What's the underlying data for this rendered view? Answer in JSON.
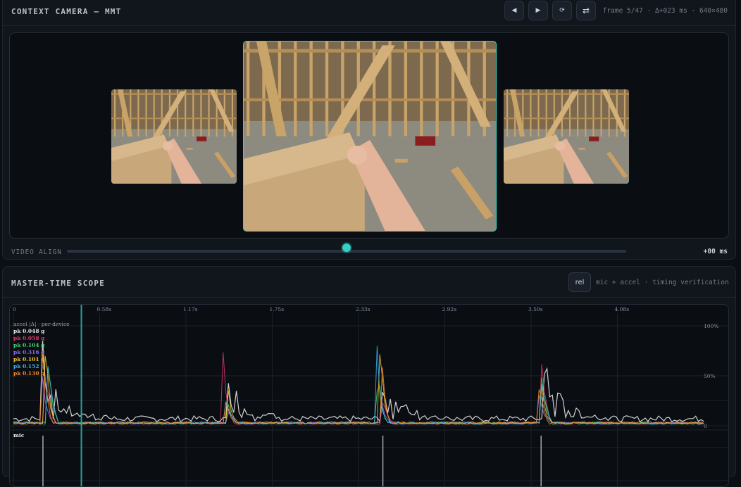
{
  "camera_panel": {
    "title": "CONTEXT CAMERA — MMT",
    "buttons": [
      {
        "name": "prev-frame-button",
        "icon": "triangle-left-icon",
        "glyph": "◀"
      },
      {
        "name": "next-frame-button",
        "icon": "triangle-right-icon",
        "glyph": "▶"
      },
      {
        "name": "reset-button",
        "icon": "refresh-icon",
        "glyph": "⟳"
      },
      {
        "name": "swap-button",
        "icon": "swap-arrows-icon",
        "glyph": "⇄"
      }
    ],
    "frame_info": "frame 5/47 · Δ+023 ms · 640×480",
    "frame_index": 5,
    "frame_total": 47
  },
  "video_align": {
    "label": "VIDEO ALIGN",
    "value": "+00 ms",
    "slider_fraction": 0.5
  },
  "scope_panel": {
    "title": "MASTER-TIME SCOPE",
    "rel_label": "rel",
    "subtitle": "mic + accel · timing verification",
    "accel_label": "accel |Δ| · per-device",
    "mic_label": "mic",
    "cursor_time_s": 0.46,
    "peaks": [
      {
        "text": "pk 0.048 g",
        "color": "#e6e6e6"
      },
      {
        "text": "pk 0.058 g",
        "color": "#e0376b"
      },
      {
        "text": "pk 0.104 g",
        "color": "#3fcf6e"
      },
      {
        "text": "pk 0.316 g",
        "color": "#8a6cf0"
      },
      {
        "text": "pk 0.101 g",
        "color": "#f2c230"
      },
      {
        "text": "pk 0.152 g",
        "color": "#3cb4e6"
      },
      {
        "text": "pk 0.130 g",
        "color": "#f08a2a"
      }
    ],
    "y_labels": [
      "100%",
      "50%",
      "0"
    ]
  },
  "chart_data": {
    "type": "line",
    "x_ticks": [
      "0",
      "0.58s",
      "1.17s",
      "1.75s",
      "2.33s",
      "2.92s",
      "3.50s",
      "4.08s"
    ],
    "x_range": [
      0,
      4.67
    ],
    "y_range": [
      0,
      100
    ],
    "grid": true,
    "series": [
      {
        "color": "#e6e6e6",
        "events": [
          [
            0.2,
            95
          ],
          [
            1.45,
            45
          ],
          [
            2.5,
            38
          ],
          [
            3.6,
            85
          ]
        ]
      },
      {
        "color": "#e0376b",
        "events": [
          [
            0.22,
            65
          ],
          [
            1.42,
            90
          ],
          [
            2.5,
            30
          ],
          [
            3.57,
            100
          ]
        ]
      },
      {
        "color": "#3fcf6e",
        "events": [
          [
            0.24,
            80
          ],
          [
            1.45,
            30
          ],
          [
            2.47,
            55
          ],
          [
            3.57,
            70
          ]
        ]
      },
      {
        "color": "#8a6cf0",
        "events": [
          [
            0.2,
            55
          ],
          [
            1.46,
            20
          ],
          [
            2.49,
            25
          ],
          [
            3.56,
            45
          ]
        ]
      },
      {
        "color": "#f2c230",
        "events": [
          [
            0.22,
            92
          ],
          [
            1.45,
            40
          ],
          [
            2.48,
            100
          ],
          [
            3.57,
            50
          ]
        ]
      },
      {
        "color": "#3cb4e6",
        "events": [
          [
            0.24,
            82
          ],
          [
            1.44,
            35
          ],
          [
            2.46,
            85
          ],
          [
            3.58,
            60
          ]
        ]
      },
      {
        "color": "#f08a2a",
        "events": [
          [
            0.2,
            100
          ],
          [
            1.44,
            30
          ],
          [
            2.49,
            88
          ],
          [
            3.56,
            55
          ]
        ]
      }
    ],
    "mic_spikes": [
      0.2,
      2.5,
      3.57
    ]
  }
}
